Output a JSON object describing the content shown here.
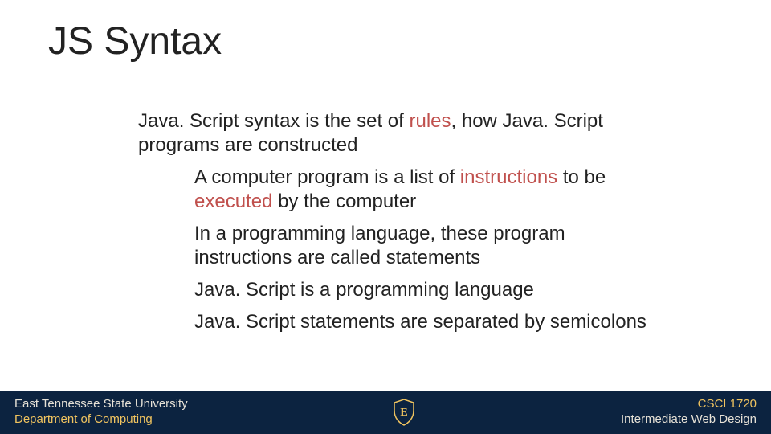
{
  "title": "JS Syntax",
  "body": {
    "intro": {
      "p1": "Java. Script syntax is the set of ",
      "h1": "rules",
      "p2": ", how Java. Script programs are constructed"
    },
    "points": [
      {
        "p1": "A computer program is a list of ",
        "h1": "instructions",
        "p2": " to be ",
        "h2": "executed",
        "p3": " by the computer"
      },
      {
        "text": "In a programming language, these program instructions are called statements"
      },
      {
        "text": "Java. Script is a programming language"
      },
      {
        "text": "Java. Script statements are separated by semicolons"
      }
    ]
  },
  "footer": {
    "left": {
      "line1": "East Tennessee State University",
      "line2": "Department of Computing"
    },
    "right": {
      "line1": "CSCI 1720",
      "line2": "Intermediate Web Design"
    },
    "badge_letter": "E"
  },
  "colors": {
    "highlight": "#c0504d",
    "footer_bg": "#0c2340",
    "gold": "#f1c45f"
  }
}
